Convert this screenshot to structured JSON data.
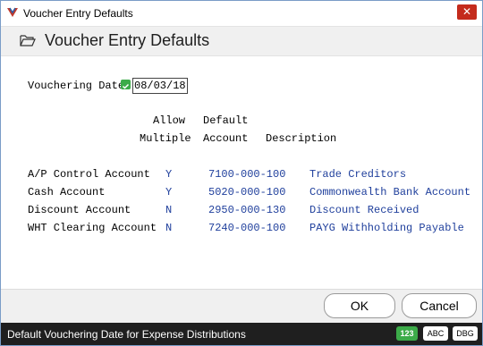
{
  "window": {
    "title": "Voucher Entry Defaults",
    "close_glyph": "✕"
  },
  "header": {
    "title": "Voucher Entry Defaults"
  },
  "form": {
    "vouchering_date_label": "Vouchering Date",
    "vouchering_date_value": "08/03/18",
    "col_allow_line1": "Allow",
    "col_allow_line2": "Multiple",
    "col_default_line1": "Default",
    "col_default_line2": "Account",
    "col_description": "Description",
    "rows": [
      {
        "label": "A/P Control Account",
        "allow": "Y",
        "account": "7100-000-100",
        "description": "Trade Creditors"
      },
      {
        "label": "Cash Account",
        "allow": "Y",
        "account": "5020-000-100",
        "description": "Commonwealth Bank Account"
      },
      {
        "label": "Discount Account",
        "allow": "N",
        "account": "2950-000-130",
        "description": "Discount Received"
      },
      {
        "label": "WHT Clearing Account",
        "allow": "N",
        "account": "7240-000-100",
        "description": "PAYG Withholding Payable"
      }
    ]
  },
  "buttons": {
    "ok": "OK",
    "cancel": "Cancel"
  },
  "status": {
    "text": "Default Vouchering Date for Expense Distributions",
    "badge_num": "123",
    "badge_abc": "ABC",
    "badge_dbg": "DBG"
  },
  "colors": {
    "value_blue": "#1f3f9c",
    "status_bg": "#1f1f1f",
    "badge_green": "#3cab49"
  },
  "icons": [
    "app-logo-icon",
    "close-icon",
    "folder-open-icon",
    "lookup-check-icon"
  ]
}
